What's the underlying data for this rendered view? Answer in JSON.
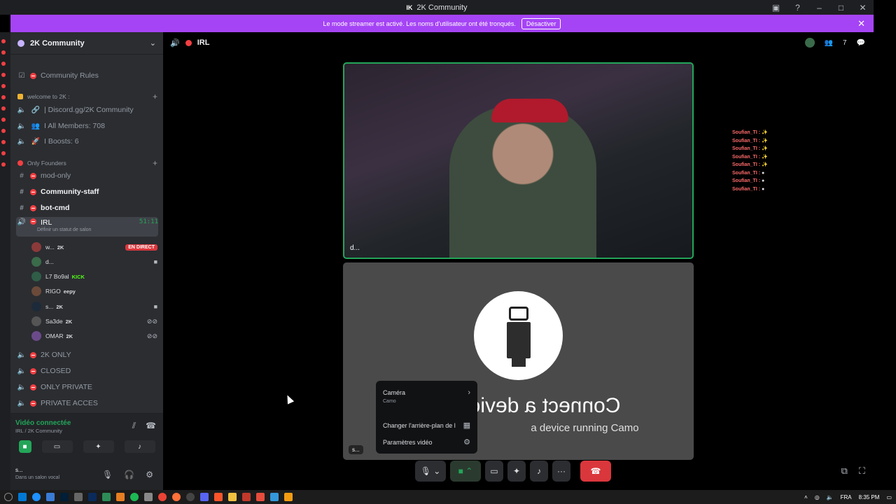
{
  "window": {
    "title": "2K Community",
    "logo_text": "IK"
  },
  "banner": {
    "message": "Le mode streamer est activé. Les noms d'utilisateur ont été tronqués.",
    "button_label": "Désactiver",
    "color": "#a544f5"
  },
  "guild": {
    "name": "2K Community"
  },
  "channels": {
    "rules": "Community  Rules",
    "cat_welcome": "welcome to 2K :",
    "discord_link": "| Discord.gg/2K Community",
    "members": "I All Members: 708",
    "boosts": "I Boosts: 6",
    "cat_founders": "Only Founders",
    "mod_only": "mod-only",
    "community_staff": "Community-staff",
    "bot_cmd": "bot-cmd",
    "irl": "IRL",
    "irl_timer": "51:11",
    "irl_status": "Définir un statut de salon",
    "two_k_only": "2K ONLY",
    "closed": "CLOSED",
    "only_private": "ONLY PRIVATE",
    "private_acces": "PRIVATE ACCES"
  },
  "voice_users": [
    {
      "name": "w...",
      "tag": "2K",
      "badge": "EN DIRECT"
    },
    {
      "name": "d...",
      "tag": ""
    },
    {
      "name": "L7 Bo9al",
      "tag": "KICK"
    },
    {
      "name": "RIGO",
      "tag": "eepy"
    },
    {
      "name": "s...",
      "tag": "2K"
    },
    {
      "name": "Sa3de",
      "tag": "2K"
    },
    {
      "name": "OMAR",
      "tag": "2K"
    }
  ],
  "voice_panel": {
    "status": "Vidéo connectée",
    "location": "IRL / 2K Community",
    "me_name": "s...",
    "me_sub": "Dans un salon vocal"
  },
  "stage": {
    "channel": "IRL",
    "participants": "7",
    "top_tile_name": "d...",
    "bottom_tile_name": "s...",
    "camo_title": "Connect a device ru",
    "camo_title_end": "o",
    "camo_sub": "a device running Camo"
  },
  "chat_overlay": [
    "Soufian_TI : ",
    "Soufian_TI : ",
    "Soufian_TI : ",
    "Soufian_TI : ",
    "Soufian_TI : ",
    "Soufian_TI : ",
    "Soufian_TI : ",
    "Soufian_TI : "
  ],
  "popup": {
    "camera_label": "Caméra",
    "camera_value": "Camo",
    "background_label": "Changer l'arrière-plan de l",
    "video_settings_label": "Paramètres vidéo"
  },
  "taskbar": {
    "language": "FRA",
    "time": "8:35 PM"
  }
}
